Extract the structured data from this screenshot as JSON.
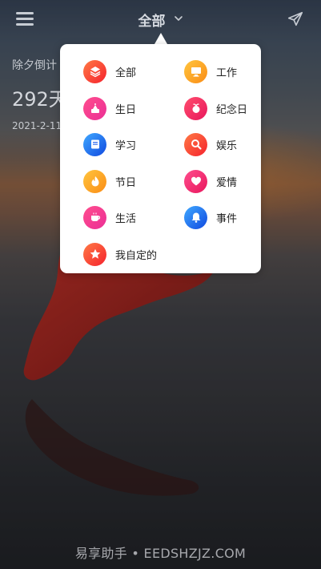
{
  "header": {
    "title": "全部"
  },
  "behind": {
    "event_title": "除夕倒计",
    "days": "292天",
    "date": "2021-2-11"
  },
  "categories": [
    {
      "label": "全部",
      "icon": "layers-icon",
      "color_a": "#ff7a45",
      "color_b": "#f5222d"
    },
    {
      "label": "工作",
      "icon": "monitor-icon",
      "color_a": "#ffc53d",
      "color_b": "#fa8c16"
    },
    {
      "label": "生日",
      "icon": "cake-icon",
      "color_a": "#ff4d8d",
      "color_b": "#eb2f96"
    },
    {
      "label": "纪念日",
      "icon": "gift-icon",
      "color_a": "#ff4d6d",
      "color_b": "#e8175d"
    },
    {
      "label": "学习",
      "icon": "book-icon",
      "color_a": "#40a9ff",
      "color_b": "#1049e0"
    },
    {
      "label": "娱乐",
      "icon": "search-icon",
      "color_a": "#ff7a45",
      "color_b": "#f5222d"
    },
    {
      "label": "节日",
      "icon": "flame-icon",
      "color_a": "#ffc53d",
      "color_b": "#fa8c16"
    },
    {
      "label": "爱情",
      "icon": "heart-icon",
      "color_a": "#ff4d8d",
      "color_b": "#e8175d"
    },
    {
      "label": "生活",
      "icon": "cup-icon",
      "color_a": "#ff4d8d",
      "color_b": "#eb2f96"
    },
    {
      "label": "事件",
      "icon": "bell-icon",
      "color_a": "#40a9ff",
      "color_b": "#1049e0"
    },
    {
      "label": "我自定的",
      "icon": "star-icon",
      "color_a": "#ff7a45",
      "color_b": "#f5222d"
    }
  ],
  "watermark": "易享助手 • EEDSHZJZ.COM"
}
